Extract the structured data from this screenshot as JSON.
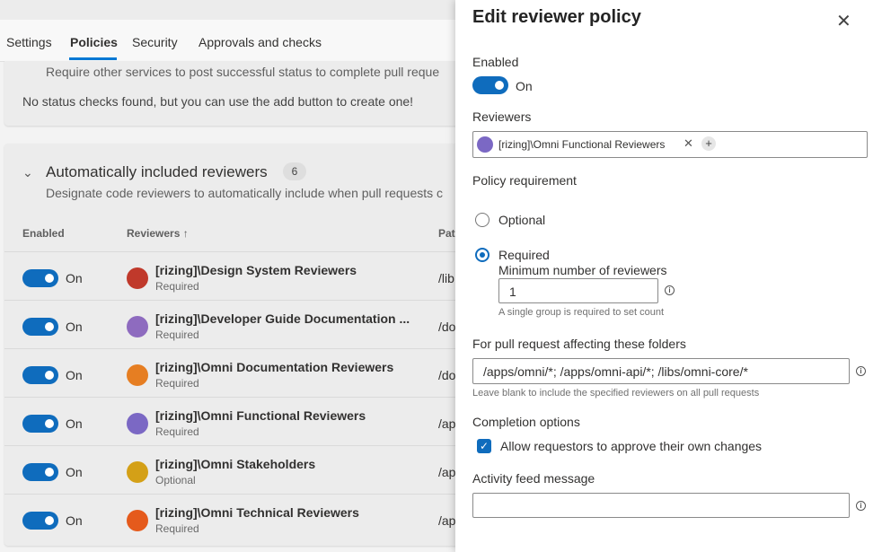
{
  "tabs": [
    {
      "label": "Settings"
    },
    {
      "label": "Policies"
    },
    {
      "label": "Security"
    },
    {
      "label": "Approvals and checks"
    }
  ],
  "status_checks": {
    "description": "Require other services to post successful status to complete pull reque",
    "empty_message": "No status checks found, but you can use the add button to create one!"
  },
  "auto_reviewers": {
    "title": "Automatically included reviewers",
    "count": "6",
    "description": "Designate code reviewers to automatically include when pull requests c",
    "columns": {
      "enabled": "Enabled",
      "reviewers": "Reviewers ↑",
      "path": "Pat"
    },
    "rows": [
      {
        "toggle": "On",
        "name": "[rizing]\\Design System Reviewers",
        "status": "Required",
        "path": "/lib",
        "avatar_color": "#c0392b"
      },
      {
        "toggle": "On",
        "name": "[rizing]\\Developer Guide Documentation ...",
        "status": "Required",
        "path": "/do",
        "avatar_color": "#8e6bbf"
      },
      {
        "toggle": "On",
        "name": "[rizing]\\Omni Documentation Reviewers",
        "status": "Required",
        "path": "/do",
        "avatar_color": "#e67e22"
      },
      {
        "toggle": "On",
        "name": "[rizing]\\Omni Functional Reviewers",
        "status": "Required",
        "path": "/ap",
        "avatar_color": "#7b68c4"
      },
      {
        "toggle": "On",
        "name": "[rizing]\\Omni Stakeholders",
        "status": "Optional",
        "path": "/ap",
        "avatar_color": "#d4a017"
      },
      {
        "toggle": "On",
        "name": "[rizing]\\Omni Technical Reviewers",
        "status": "Required",
        "path": "/ap",
        "avatar_color": "#e55a1c"
      }
    ]
  },
  "panel": {
    "title": "Edit reviewer policy",
    "enabled_label": "Enabled",
    "enabled_value": "On",
    "reviewers_label": "Reviewers",
    "reviewer_chip": "[rizing]\\Omni Functional Reviewers",
    "policy_requirement_label": "Policy requirement",
    "option_optional": "Optional",
    "option_required": "Required",
    "selected_requirement": "Required",
    "min_reviewers_label": "Minimum number of reviewers",
    "min_reviewers_value": "1",
    "min_reviewers_hint": "A single group is required to set count",
    "folders_label": "For pull request affecting these folders",
    "folders_value": "/apps/omni/*; /apps/omni-api/*; /libs/omni-core/*",
    "folders_hint": "Leave blank to include the specified reviewers on all pull requests",
    "completion_label": "Completion options",
    "completion_checkbox": "Allow requestors to approve their own changes",
    "completion_checked": true,
    "activity_label": "Activity feed message",
    "activity_value": ""
  },
  "colors": {
    "accent": "#0f6cbd"
  }
}
